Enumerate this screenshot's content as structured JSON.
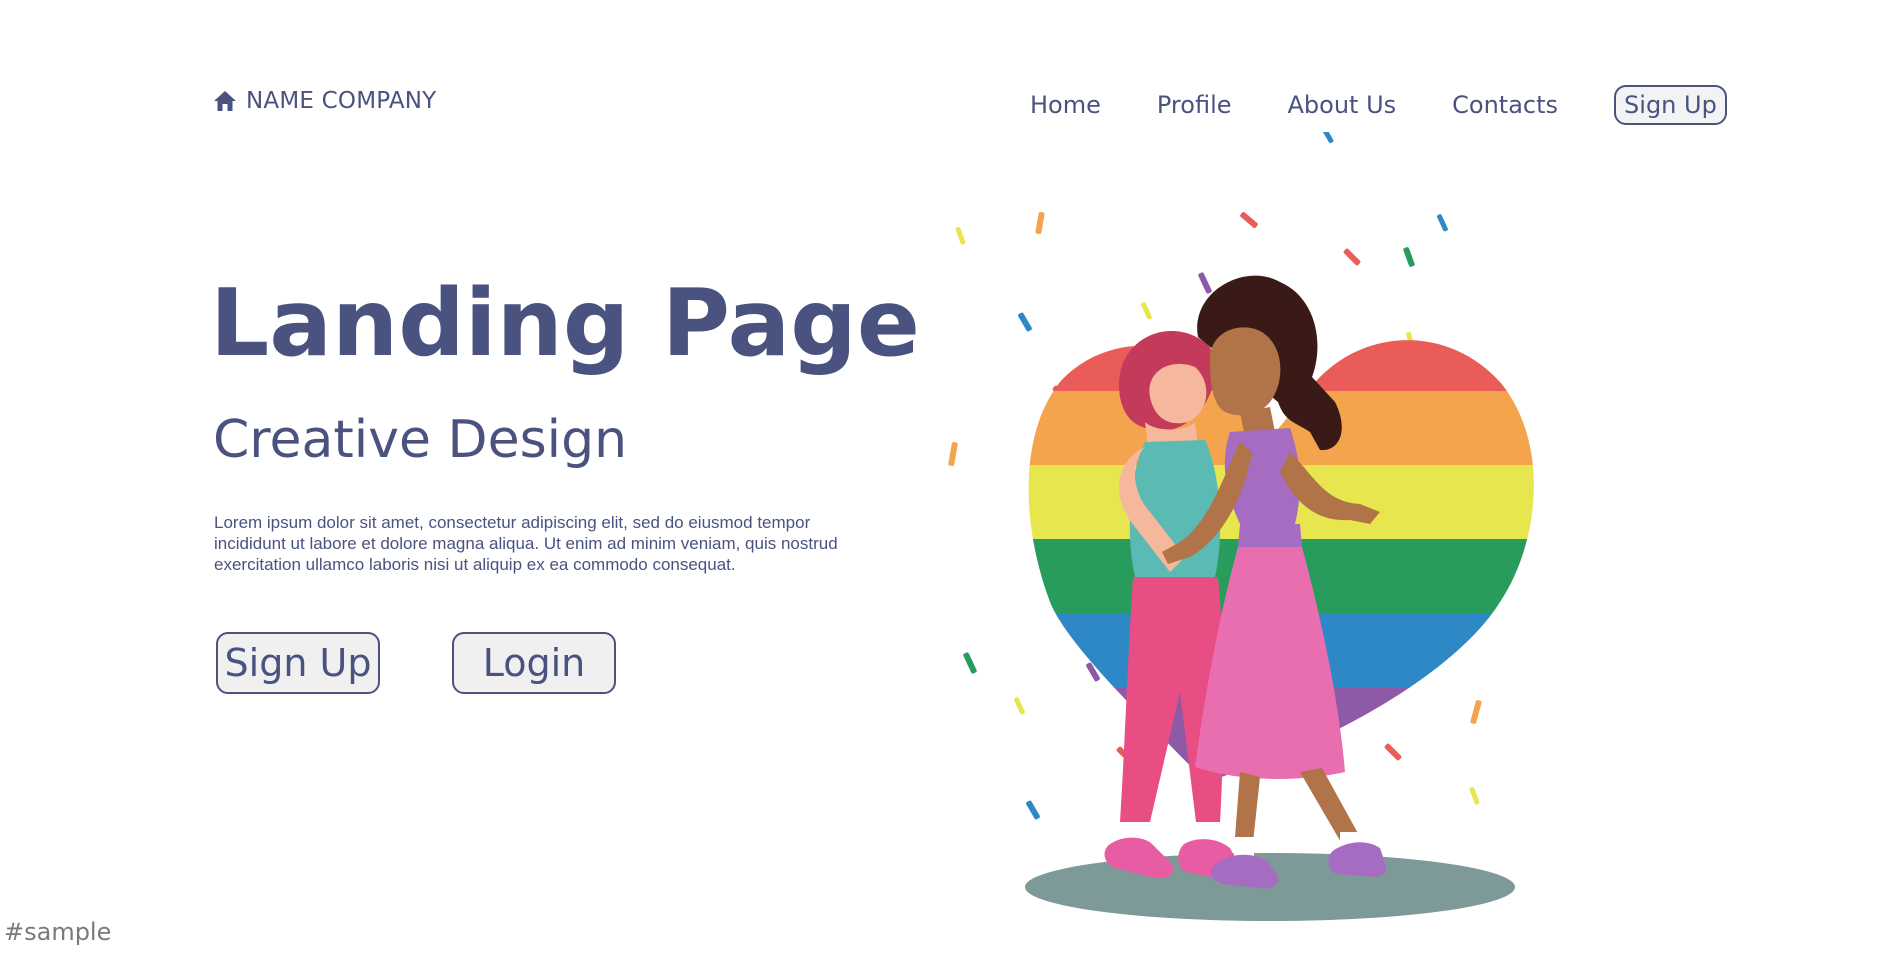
{
  "header": {
    "company_name": "NAME COMPANY",
    "nav": [
      "Home",
      "Profile",
      "About Us",
      "Contacts"
    ],
    "signup_label": "Sign Up"
  },
  "hero": {
    "title": "Landing Page",
    "subtitle": "Creative Design",
    "body": "Lorem ipsum dolor sit amet, consectetur adipiscing elit, sed do eiusmod tempor incididunt ut labore et dolore magna aliqua. Ut enim ad minim veniam, quis nostrud exercitation ullamco laboris nisi ut aliquip ex ea commodo consequat.",
    "signup_label": "Sign Up",
    "login_label": "Login"
  },
  "watermark": "#sample",
  "colors": {
    "brand_text": "#4a5280",
    "button_bg": "#f0f0f0",
    "rainbow": [
      "#e95c57",
      "#f3a44c",
      "#e7e64f",
      "#279c5c",
      "#2f88c6",
      "#8e5aa8"
    ]
  },
  "icons": {
    "logo": "home-icon"
  }
}
